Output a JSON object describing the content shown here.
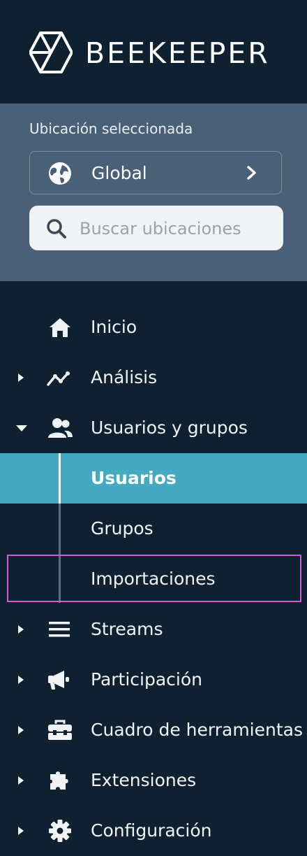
{
  "brand": {
    "name": "BEEKEEPER"
  },
  "location": {
    "label": "Ubicación seleccionada",
    "selected": "Global",
    "search_placeholder": "Buscar ubicaciones"
  },
  "nav": {
    "items": [
      {
        "label": "Inicio",
        "icon": "home-icon"
      },
      {
        "label": "Análisis",
        "icon": "analytics-icon"
      },
      {
        "label": "Usuarios y grupos",
        "icon": "users-icon",
        "expanded": true
      },
      {
        "label": "Streams",
        "icon": "streams-icon"
      },
      {
        "label": "Participación",
        "icon": "megaphone-icon"
      },
      {
        "label": "Cuadro de herramientas",
        "icon": "toolbox-icon"
      },
      {
        "label": "Extensiones",
        "icon": "puzzle-icon"
      },
      {
        "label": "Configuración",
        "icon": "gear-icon"
      }
    ],
    "sub_items": [
      {
        "label": "Usuarios",
        "active": true
      },
      {
        "label": "Grupos"
      },
      {
        "label": "Importaciones",
        "highlighted": true
      }
    ]
  },
  "colors": {
    "background": "#0f2031",
    "panel": "#4a6076",
    "active": "#44a9c1",
    "highlight": "#d25ad6"
  }
}
